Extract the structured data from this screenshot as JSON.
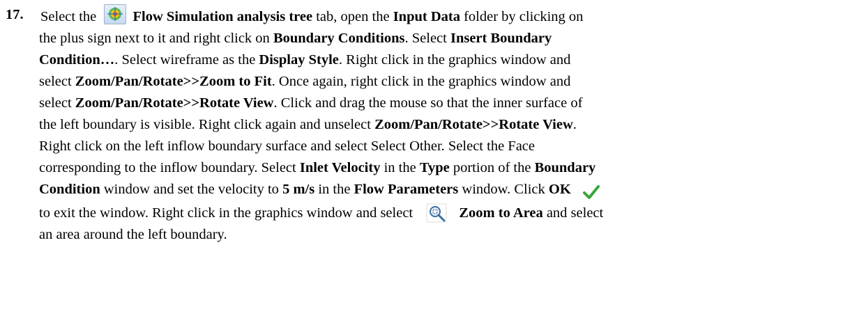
{
  "step": {
    "number": "17.",
    "lines": [
      [
        "Select the",
        "Flow Simulation analysis tree",
        "tab, open the",
        "Input Data",
        "folder by clicking on"
      ],
      [
        "the plus sign next to it and right click on",
        "Boundary Conditions",
        ". Select",
        "Insert Boundary"
      ],
      [
        "Condition…",
        ". Select wireframe as the",
        "Display Style",
        ". Right click in the graphics window and"
      ],
      [
        "select",
        "Zoom/Pan/Rotate>>Zoom to Fit",
        ". Once again, right click in the graphics window and"
      ],
      [
        "select",
        "Zoom/Pan/Rotate>>Rotate View",
        ". Click and drag the mouse so that the inner surface of"
      ],
      [
        "the left boundary is visible. Right click again and unselect",
        "Zoom/Pan/Rotate>>Rotate View",
        "."
      ],
      [
        "Right click on the left inflow boundary surface and select Select Other. Select the Face"
      ],
      [
        "corresponding to the inflow boundary. Select",
        "Inlet Velocity",
        "in the",
        "Type",
        "portion of the",
        "Boundary"
      ],
      [
        "Condition",
        "window and set the velocity to",
        "5 m/s",
        "in the",
        "Flow Parameters",
        "window. Click",
        "OK"
      ],
      [
        "to exit the window. Right click in the graphics window and select",
        "Zoom to Area",
        "and select"
      ],
      [
        "an area around the left boundary."
      ]
    ]
  },
  "icons": {
    "analysis_tree": "flow-simulation-tree-icon",
    "ok": "checkmark-icon",
    "zoom_area": "zoom-to-area-icon"
  }
}
